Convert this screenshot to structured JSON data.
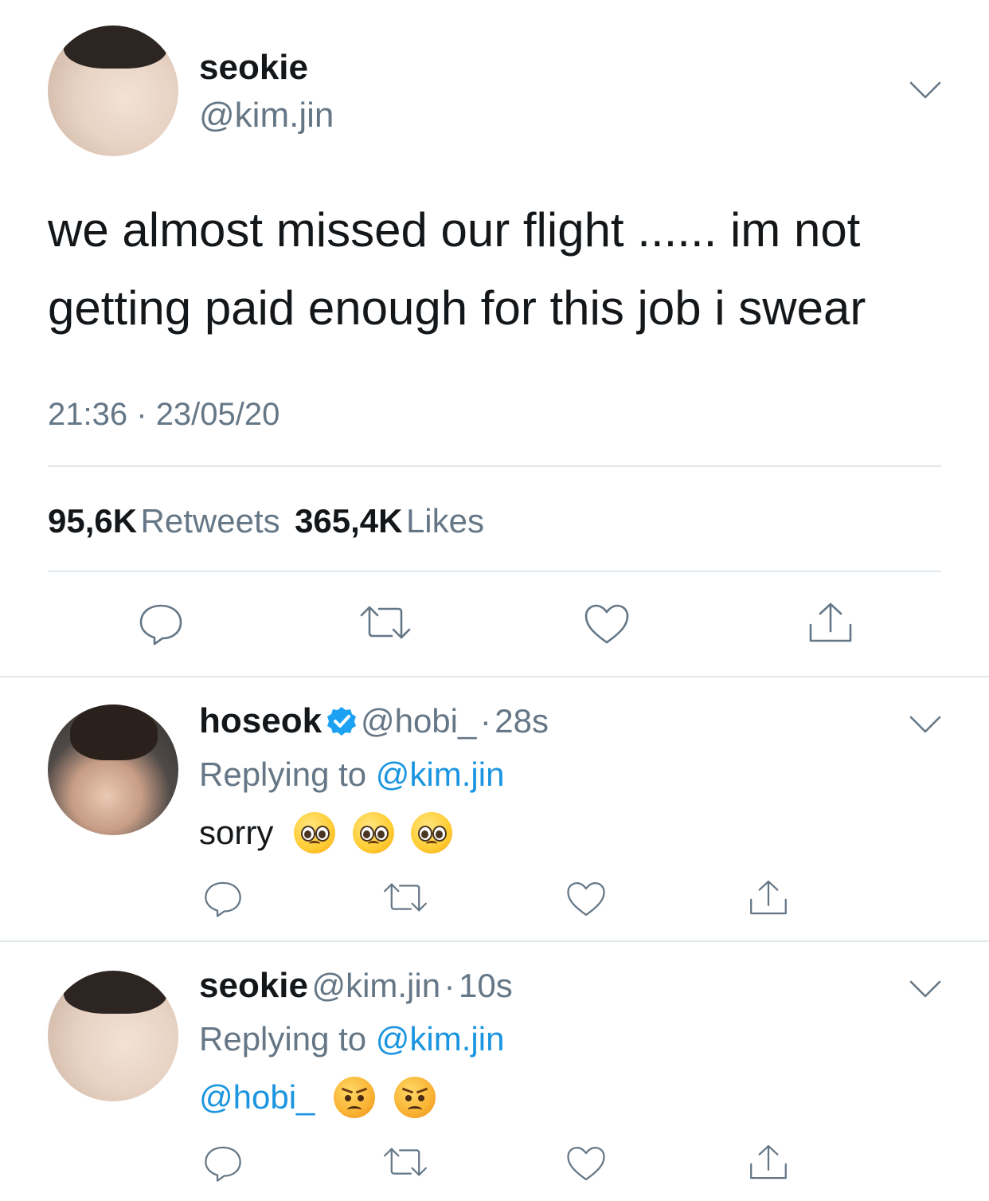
{
  "main_tweet": {
    "name": "seokie",
    "handle": "@kim.jin",
    "text_line1": "we almost missed our flight ...... im not",
    "text_line2": "getting paid enough for this job i swear",
    "time": "21:36",
    "separator": "·",
    "date": "23/05/20",
    "retweets_count": "95,6K",
    "retweets_label": "Retweets",
    "likes_count": "365,4K",
    "likes_label": "Likes"
  },
  "replies": [
    {
      "name": "hoseok",
      "verified": true,
      "handle": "@hobi_",
      "separator": "·",
      "time": "28s",
      "replying_prefix": "Replying to",
      "replying_to": "@kim.jin",
      "text": "sorry",
      "emojis": [
        "pleading-face",
        "pleading-face",
        "pleading-face"
      ]
    },
    {
      "name": "seokie",
      "verified": false,
      "handle": "@kim.jin",
      "separator": "·",
      "time": "10s",
      "replying_prefix": "Replying to",
      "replying_to": "@kim.jin",
      "mention": "@hobi_",
      "emojis": [
        "angry-face",
        "angry-face"
      ]
    }
  ],
  "colors": {
    "text": "#14171a",
    "secondary": "#657786",
    "link": "#1b95e0",
    "divider": "#e1e8ed",
    "verified": "#1da1f2"
  },
  "icons": [
    "chevron-down-icon",
    "reply-icon",
    "retweet-icon",
    "like-icon",
    "share-icon",
    "verified-icon"
  ]
}
